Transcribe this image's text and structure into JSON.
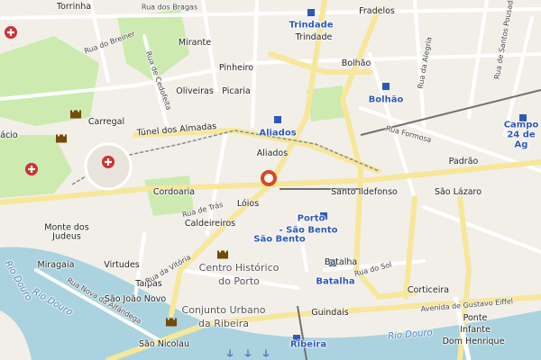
{
  "map": {
    "colors": {
      "background": "#f2efe9",
      "water": "#aad3df",
      "primary_road": "#f6e79b",
      "secondary_road": "#ffffff",
      "park": "#cdebb0",
      "metro": "#2e58b5",
      "hospital": "#cc3333",
      "marker": "#d9481f"
    },
    "labels": {
      "torrinha": "Torrinha",
      "rua_bragas": "Rua dos Bragas",
      "rua_breiner": "Rua do Breiner",
      "rua_cedofeita": "Rua de Cedofeita",
      "mirante": "Mirante",
      "pinheiro": "Pinheiro",
      "trindade_station": "Trindade",
      "trindade": "Trindade",
      "fradelos": "Fradelos",
      "bolhao": "Bolhão",
      "bolhao_station": "Bolhão",
      "oliveiras": "Oliveiras",
      "picaria": "Picaria",
      "carregal": "Carregal",
      "tunel_almadas": "Túnel dos Almadas",
      "aliados_station": "Aliados",
      "aliados": "Aliados",
      "rua_formosa": "Rua Formosa",
      "padrao": "Padrão",
      "campo24": "Campo 24 de Ag",
      "rua_alegria": "Rua da Alegria",
      "cordoaria": "Cordoaria",
      "santo_ildefonso": "Santo Ildefonso",
      "sao_lazaro": "São Lázaro",
      "loios": "Lóios",
      "rua_tras": "Rua de Trás",
      "caldeireiros": "Caldeireiros",
      "porto_sao_bento_1": "Porto",
      "porto_sao_bento_2": "- São Bento",
      "sao_bento": "São Bento",
      "monte_judeus": "Monte dos Judeus",
      "miragaia": "Miragaia",
      "virtudes": "Virtudes",
      "taipas": "Taipas",
      "rua_vitoria": "Rua da Vitória",
      "centro_historico_1": "Centro Histórico",
      "centro_historico_2": "do Porto",
      "batalha": "Batalha",
      "batalha_station": "Batalha",
      "rua_sol": "Rua do Sol",
      "corticeira": "Corticeira",
      "rua_nova_alfandega": "Rua Nova da Alfândega",
      "sao_joao_novo": "São João Novo",
      "conjunto_1": "Conjunto Urbano",
      "conjunto_2": "da Ribeira",
      "guindais": "Guindais",
      "avenida_eiffel": "Avenida de Gustavo Eiffel",
      "ponte_1": "Ponte",
      "ponte_2": "Infante",
      "ponte_3": "Dom Henrique",
      "rio_douro_1": "Rio Douro",
      "rio_douro_2": "Rio Douro",
      "rio_douro_3": "Rio Douro",
      "ribeira_station": "Ribeira",
      "sao_nicolau": "São Nicolau",
      "acio": "ácio",
      "rua_santos_pousada": "Rua de Santos Pousada"
    },
    "icons": [
      "hospital-icon",
      "castle-icon",
      "metro-station-icon",
      "location-marker-icon",
      "anchor-icon"
    ]
  }
}
